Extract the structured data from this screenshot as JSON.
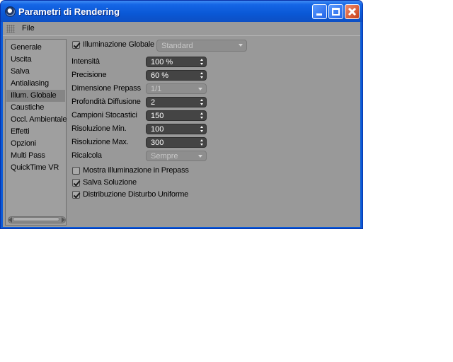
{
  "window": {
    "title": "Parametri di Rendering"
  },
  "menu": {
    "file": "File"
  },
  "sidebar": {
    "items": [
      {
        "label": "Generale"
      },
      {
        "label": "Uscita"
      },
      {
        "label": "Salva"
      },
      {
        "label": "Antialiasing"
      },
      {
        "label": "Illum. Globale",
        "selected": true
      },
      {
        "label": "Caustiche"
      },
      {
        "label": "Occl. Ambientale"
      },
      {
        "label": "Effetti"
      },
      {
        "label": "Opzioni"
      },
      {
        "label": "Multi Pass"
      },
      {
        "label": "QuickTime VR"
      }
    ]
  },
  "gi": {
    "enable_label": "Illuminazione Globale",
    "enabled": true,
    "mode": "Standard"
  },
  "params": [
    {
      "label": "Intensità",
      "value": "100 %",
      "type": "spin"
    },
    {
      "label": "Precisione",
      "value": "60 %",
      "type": "spin"
    },
    {
      "label": "Dimensione Prepass",
      "value": "1/1",
      "type": "dropdown"
    },
    {
      "label": "Profondità Diffusione",
      "value": "2",
      "type": "spin"
    },
    {
      "label": "Campioni Stocastici",
      "value": "150",
      "type": "spin"
    },
    {
      "label": "Risoluzione Min.",
      "value": "100",
      "type": "spin"
    },
    {
      "label": "Risoluzione Max.",
      "value": "300",
      "type": "spin"
    },
    {
      "label": "Ricalcola",
      "value": "Sempre",
      "type": "dropdown"
    }
  ],
  "options": [
    {
      "label": "Mostra Illuminazione in Prepass",
      "checked": false
    },
    {
      "label": "Salva Soluzione",
      "checked": true
    },
    {
      "label": "Distribuzione Disturbo Uniforme",
      "checked": true
    }
  ],
  "colors": {
    "titlebar": "#0a58d6",
    "panel_bg": "#999999",
    "spin_bg": "#444444"
  }
}
